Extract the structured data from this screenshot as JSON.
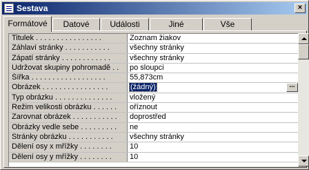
{
  "window": {
    "title": "Sestava",
    "close_glyph": "×"
  },
  "tabs": [
    {
      "label": "Formátové",
      "active": true
    },
    {
      "label": "Datové",
      "active": false
    },
    {
      "label": "Události",
      "active": false
    },
    {
      "label": "Jiné",
      "active": false
    },
    {
      "label": "Vše",
      "active": false
    }
  ],
  "properties": [
    {
      "label": "Titulek . . . . . . . . . . . . . . . .",
      "value": "Zoznam žiakov"
    },
    {
      "label": "Záhlaví stránky . . . . . . . . . . .",
      "value": "všechny stránky"
    },
    {
      "label": "Zápatí stránky . . . . . . . . . . . .",
      "value": "všechny stránky"
    },
    {
      "label": "Udržovat skupiny pohromadě . .",
      "value": "po sloupci"
    },
    {
      "label": "Šířka . . . . . . . . . . . . . . . . . .",
      "value": "55,873cm"
    },
    {
      "label": "Obrázek . . . . . . . . . . . . . . . .",
      "value": "(žádný)",
      "selected": true,
      "builder": "..."
    },
    {
      "label": "Typ obrázku . . . . . . . . . . . . . .",
      "value": "vložený"
    },
    {
      "label": "Režim velikosti obrázku . . . . . .",
      "value": "oříznout"
    },
    {
      "label": "Zarovnat obrázek . . . . . . . . . . .",
      "value": "doprostřed"
    },
    {
      "label": "Obrázky vedle sebe . . . . . . . . .",
      "value": "ne"
    },
    {
      "label": "Stránky obrázku . . . . . . . . . . .",
      "value": "všechny stránky"
    },
    {
      "label": "Dělení osy x mřížky . . . . . . . .",
      "value": "10"
    },
    {
      "label": "Dělení osy y mřížky . . . . . . . .",
      "value": "10"
    }
  ],
  "colors": {
    "titlebar_start": "#0a246a",
    "titlebar_end": "#a6caf0",
    "selection": "#0a246a",
    "face": "#d4d0c8"
  }
}
